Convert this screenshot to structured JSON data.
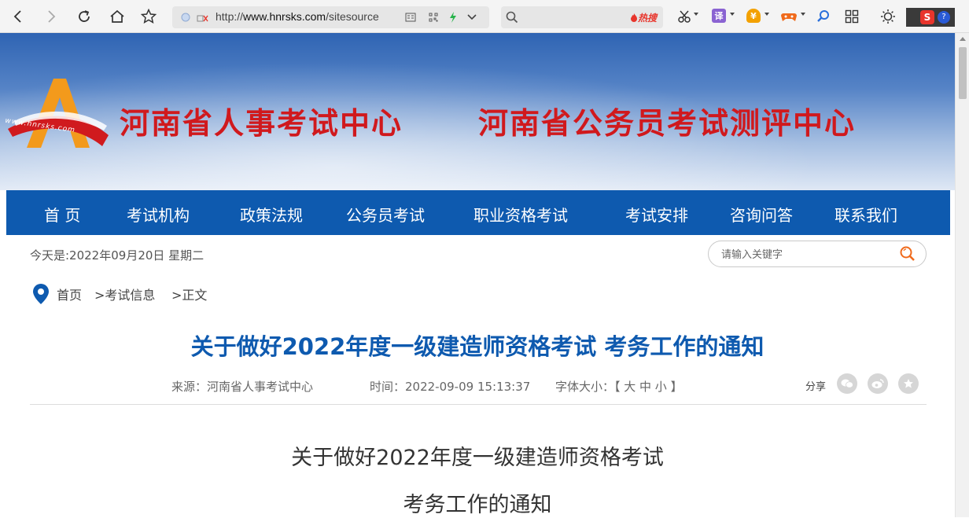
{
  "browser": {
    "url_prefix": "http://",
    "url_host": "www.hnrsks.com",
    "url_path": "/sitesource",
    "search_hot_label": "热搜",
    "translate_label": "译",
    "colors": {
      "toolbar_bg": "#f4f4f4",
      "hot": "#e8352c"
    }
  },
  "banner": {
    "title_left": "河南省人事考试中心",
    "title_right": "河南省公务员考试测评中心",
    "logo_text": "www.hnrsks.com",
    "colors": {
      "title": "#d0191d",
      "sky": "#2f64b3"
    }
  },
  "nav": {
    "items": [
      {
        "label": "首 页"
      },
      {
        "label": "考试机构"
      },
      {
        "label": "政策法规"
      },
      {
        "label": "公务员考试"
      },
      {
        "label": "职业资格考试"
      },
      {
        "label": "考试安排"
      },
      {
        "label": "咨询问答"
      },
      {
        "label": "联系我们"
      }
    ],
    "color": "#0e5aaf"
  },
  "date_text": "今天是:2022年09月20日 星期二",
  "search": {
    "placeholder": "请输入关键字"
  },
  "breadcrumb": {
    "home": "首页",
    "section": ">考试信息",
    "current": ">正文"
  },
  "article": {
    "title": "关于做好2022年度一级建造师资格考试 考务工作的通知",
    "source": "来源：河南省人事考试中心",
    "time": "时间：2022-09-09 15:13:37",
    "font_size_label": "字体大小：【 大 中 小 】",
    "share_label": "分享",
    "body_line1": "关于做好2022年度一级建造师资格考试",
    "body_line2": "考务工作的通知"
  }
}
